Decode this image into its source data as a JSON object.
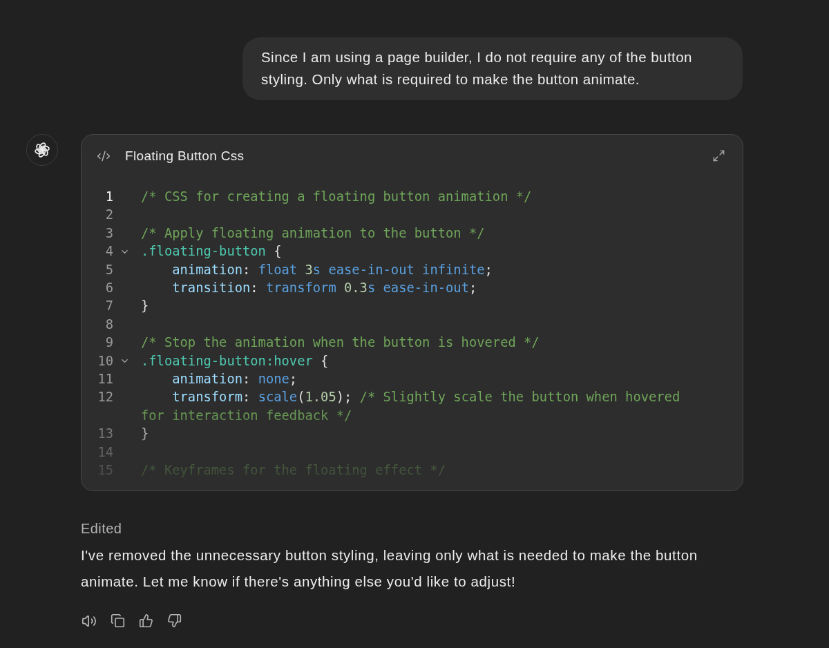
{
  "user_message": {
    "text": "Since I am using a page builder, I do not require any of the button styling. Only what is required to make the button animate."
  },
  "assistant": {
    "canvas": {
      "title": "Floating Button Css",
      "lines": [
        {
          "number": "1",
          "current": true,
          "foldable": false,
          "tokens": [
            {
              "kind": "comment",
              "text": "/* CSS for creating a floating button animation */"
            }
          ]
        },
        {
          "number": "2",
          "current": false,
          "foldable": false
        },
        {
          "number": "3",
          "current": false,
          "foldable": false,
          "tokens": [
            {
              "kind": "comment",
              "text": "/* Apply floating animation to the button */"
            }
          ]
        },
        {
          "number": "4",
          "current": false,
          "foldable": true,
          "tokens": [
            {
              "kind": "selector",
              "text": ".floating-button"
            },
            {
              "kind": "plain",
              "text": " {"
            }
          ]
        },
        {
          "number": "5",
          "current": false,
          "foldable": false,
          "tokens": [
            {
              "kind": "property",
              "text": "    animation"
            },
            {
              "kind": "plain",
              "text": ": "
            },
            {
              "kind": "value",
              "text": "float"
            },
            {
              "kind": "number",
              "text": " 3"
            },
            {
              "kind": "value",
              "text": "s"
            },
            {
              "kind": "value",
              "text": " ease-in-out"
            },
            {
              "kind": "value",
              "text": " infinite"
            },
            {
              "kind": "plain",
              "text": ";"
            }
          ]
        },
        {
          "number": "6",
          "current": false,
          "foldable": false,
          "tokens": [
            {
              "kind": "property",
              "text": "    transition"
            },
            {
              "kind": "plain",
              "text": ": "
            },
            {
              "kind": "value",
              "text": "transform"
            },
            {
              "kind": "number",
              "text": " 0.3"
            },
            {
              "kind": "value",
              "text": "s"
            },
            {
              "kind": "value",
              "text": " ease-in-out"
            },
            {
              "kind": "plain",
              "text": ";"
            }
          ]
        },
        {
          "number": "7",
          "current": false,
          "foldable": false,
          "tokens": [
            {
              "kind": "plain",
              "text": "}"
            }
          ]
        },
        {
          "number": "8",
          "current": false,
          "foldable": false
        },
        {
          "number": "9",
          "current": false,
          "foldable": false,
          "tokens": [
            {
              "kind": "comment",
              "text": "/* Stop the animation when the button is hovered */"
            }
          ]
        },
        {
          "number": "10",
          "current": false,
          "foldable": true,
          "tokens": [
            {
              "kind": "selector",
              "text": ".floating-button:hover"
            },
            {
              "kind": "plain",
              "text": " {"
            }
          ]
        },
        {
          "number": "11",
          "current": false,
          "foldable": false,
          "tokens": [
            {
              "kind": "property",
              "text": "    animation"
            },
            {
              "kind": "plain",
              "text": ": "
            },
            {
              "kind": "value",
              "text": "none"
            },
            {
              "kind": "plain",
              "text": ";"
            }
          ]
        },
        {
          "number": "12",
          "current": false,
          "foldable": false,
          "tokens": [
            {
              "kind": "property",
              "text": "    transform"
            },
            {
              "kind": "plain",
              "text": ": "
            },
            {
              "kind": "value",
              "text": "scale"
            },
            {
              "kind": "plain",
              "text": "("
            },
            {
              "kind": "number",
              "text": "1.05"
            },
            {
              "kind": "plain",
              "text": "); "
            },
            {
              "kind": "comment",
              "text": "/* Slightly scale the button when hovered for interaction feedback */"
            }
          ]
        },
        {
          "number": "13",
          "current": false,
          "foldable": false,
          "tokens": [
            {
              "kind": "plain",
              "text": "}"
            }
          ]
        },
        {
          "number": "14",
          "current": false,
          "foldable": false
        },
        {
          "number": "15",
          "current": false,
          "foldable": false,
          "tokens": [
            {
              "kind": "comment",
              "text": "/* Keyframes for the floating effect */"
            }
          ]
        }
      ]
    },
    "status": "Edited",
    "message": "I've removed the unnecessary button styling, leaving only what is needed to make the button animate. Let me know if there's anything else you'd like to adjust!"
  }
}
